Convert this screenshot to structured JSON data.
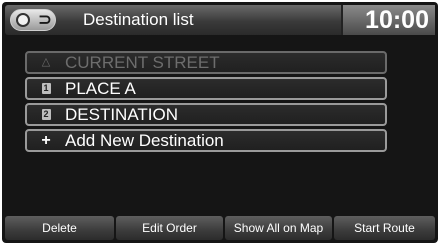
{
  "header": {
    "title": "Destination list",
    "clock": "10:00",
    "nav_icon": "navigation-compass-icon",
    "back_icon": "back-arrow-icon",
    "back_glyph": "⊃"
  },
  "list": {
    "items": [
      {
        "icon": "triangle-icon",
        "glyph": "△",
        "label": "CURRENT STREET",
        "enabled": false
      },
      {
        "icon": "number-one-icon",
        "glyph": "1",
        "label": "PLACE A",
        "enabled": true
      },
      {
        "icon": "number-two-icon",
        "glyph": "2",
        "label": "DESTINATION",
        "enabled": true
      },
      {
        "icon": "plus-icon",
        "glyph": "+",
        "label": "Add New Destination",
        "enabled": true
      }
    ]
  },
  "bottom_bar": {
    "delete": "Delete",
    "edit_order": "Edit Order",
    "show_all_on_map": "Show All on Map",
    "start_route": "Start Route"
  },
  "colors": {
    "screen_bg": "#151515",
    "item_border": "#9a9a9a",
    "disabled_text": "#6d6d6d"
  }
}
